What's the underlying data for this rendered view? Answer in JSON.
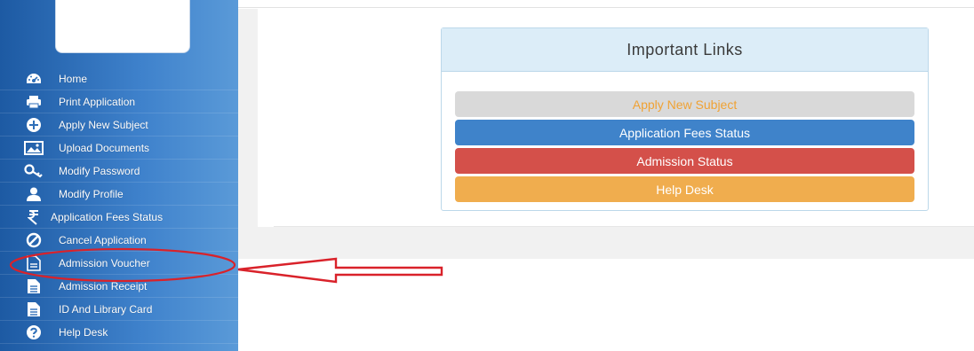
{
  "sidebar": {
    "items": [
      {
        "label": "Home",
        "icon": "dashboard-icon"
      },
      {
        "label": "Print Application",
        "icon": "printer-icon"
      },
      {
        "label": "Apply New Subject",
        "icon": "plus-circle-icon"
      },
      {
        "label": "Upload Documents",
        "icon": "image-icon"
      },
      {
        "label": "Modify Password",
        "icon": "key-icon"
      },
      {
        "label": "Modify Profile",
        "icon": "user-icon"
      },
      {
        "label": "Application Fees Status",
        "icon": "rupee-icon"
      },
      {
        "label": "Cancel Application",
        "icon": "ban-icon"
      },
      {
        "label": "Admission Voucher",
        "icon": "document-icon"
      },
      {
        "label": "Admission Receipt",
        "icon": "document-icon"
      },
      {
        "label": "ID And Library Card",
        "icon": "document-icon"
      },
      {
        "label": "Help Desk",
        "icon": "question-circle-icon"
      }
    ]
  },
  "panel": {
    "title": "Important Links",
    "buttons": {
      "apply": "Apply New Subject",
      "fees": "Application Fees Status",
      "admission": "Admission Status",
      "help": "Help Desk"
    }
  },
  "colors": {
    "sidebar": "#3f82cc",
    "panel_head": "#dcedf8",
    "apply_bg": "#d9d9d9",
    "apply_text": "#f0a234",
    "fees_bg": "#3f83ca",
    "admission_bg": "#d4504a",
    "help_bg": "#f0ad4e",
    "annotation": "#d9222a"
  }
}
